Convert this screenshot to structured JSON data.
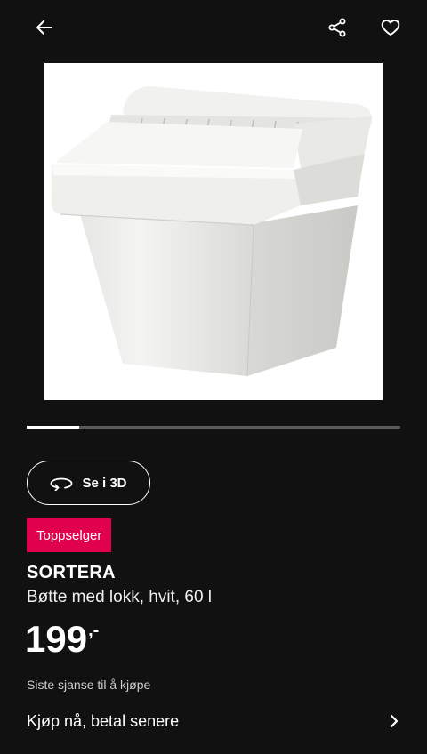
{
  "header": {
    "back_icon": "arrow-left-icon",
    "share_icon": "share-icon",
    "favorite_icon": "heart-icon"
  },
  "gallery": {
    "image_alt": "SORTERA Bøtte med lokk",
    "progress": 0.14
  },
  "view_3d": {
    "label": "Se i 3D",
    "icon": "rotate-3d-icon"
  },
  "badge": {
    "label": "Toppselger",
    "color": "#e0004d"
  },
  "product": {
    "name": "SORTERA",
    "description": "Bøtte med lokk, hvit, 60 l",
    "price_integer": "199",
    "price_decimal": ",-",
    "notice": "Siste sjanse til å kjøpe"
  },
  "bnpl": {
    "label": "Kjøp nå, betal senere",
    "icon": "chevron-right-icon"
  }
}
